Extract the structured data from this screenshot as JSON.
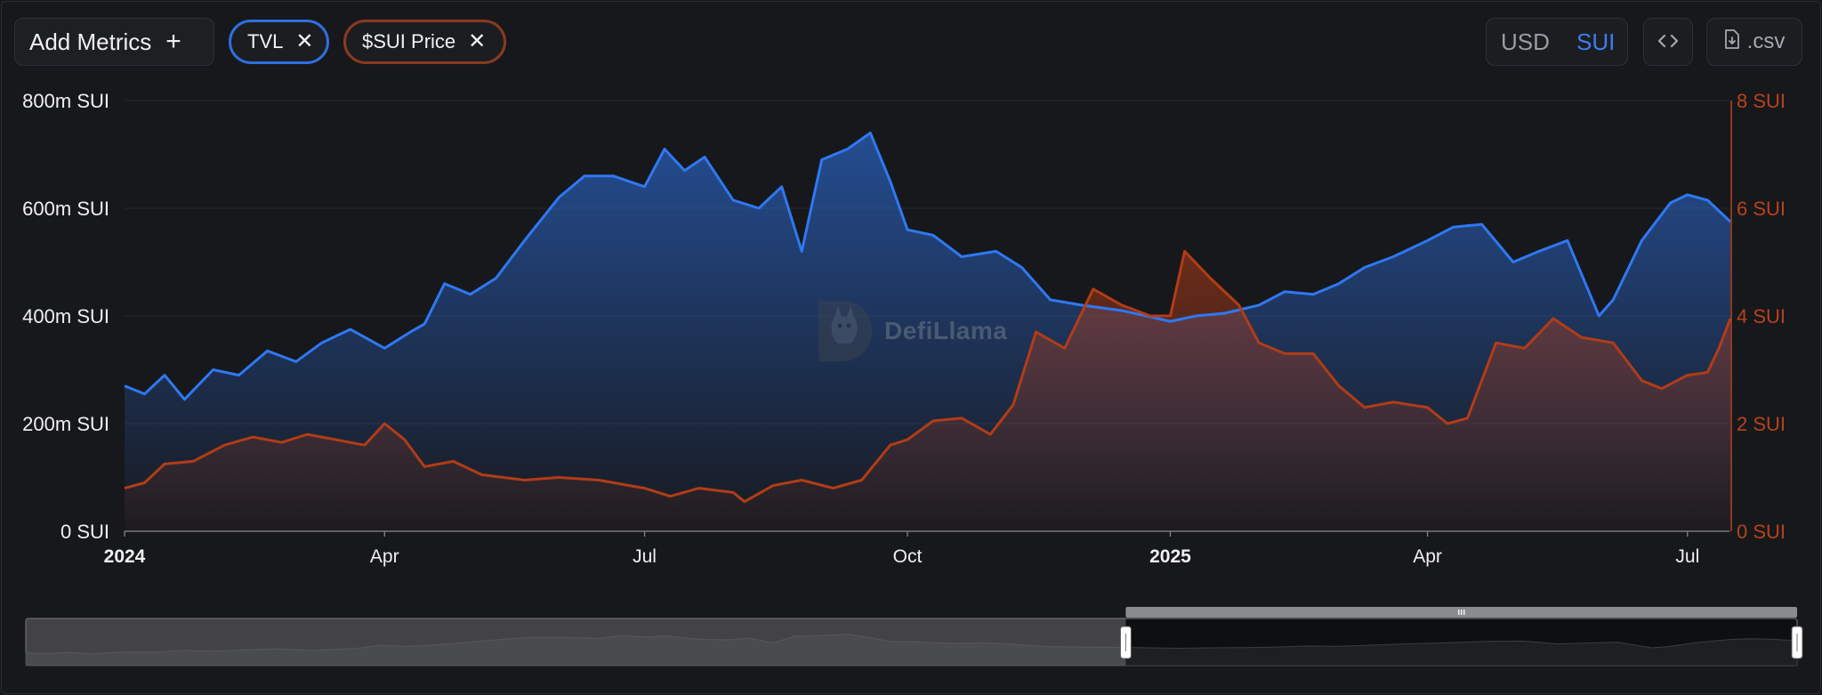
{
  "toolbar": {
    "add_metrics_label": "Add Metrics",
    "metric_pills": [
      {
        "label": "TVL",
        "color": "#2f6fe0"
      },
      {
        "label": "$SUI Price",
        "color": "#8a3a1f"
      }
    ],
    "denomination": {
      "options": [
        "USD",
        "SUI"
      ],
      "selected": "SUI"
    },
    "embed_icon": "code-brackets-icon",
    "csv_label": ".csv",
    "csv_icon": "file-download-icon"
  },
  "watermark": {
    "text": "DefiLlama"
  },
  "colors": {
    "tvl_line": "#2f78f2",
    "price_line": "#b23c17",
    "background": "#17181b",
    "right_axis": "#b8421c"
  },
  "chart_data": {
    "type": "area",
    "x_labels": [
      "2024",
      "Apr",
      "Jul",
      "Oct",
      "2025",
      "Apr",
      "Jul"
    ],
    "bold_x_labels": [
      "2024",
      "2025"
    ],
    "x_label_dates": [
      "2024-01-01",
      "2024-04-01",
      "2024-07-01",
      "2024-10-01",
      "2025-01-01",
      "2025-04-01",
      "2025-07-01"
    ],
    "x_range": [
      "2024-01-01",
      "2025-07-16"
    ],
    "left_axis": {
      "ticks": [
        "0 SUI",
        "200m SUI",
        "400m SUI",
        "600m SUI",
        "800m SUI"
      ],
      "range": [
        0,
        800000000
      ]
    },
    "right_axis": {
      "ticks": [
        "0 SUI",
        "2 SUI",
        "4 SUI",
        "6 SUI",
        "8 SUI"
      ],
      "range": [
        0,
        8
      ]
    },
    "grid": true,
    "series": [
      {
        "name": "TVL",
        "axis": "left",
        "color": "#2f78f2",
        "points": [
          [
            "2024-01-01",
            270000000
          ],
          [
            "2024-01-08",
            255000000
          ],
          [
            "2024-01-15",
            290000000
          ],
          [
            "2024-01-22",
            245000000
          ],
          [
            "2024-02-01",
            300000000
          ],
          [
            "2024-02-10",
            290000000
          ],
          [
            "2024-02-20",
            335000000
          ],
          [
            "2024-03-01",
            315000000
          ],
          [
            "2024-03-10",
            350000000
          ],
          [
            "2024-03-20",
            375000000
          ],
          [
            "2024-04-01",
            340000000
          ],
          [
            "2024-04-10",
            370000000
          ],
          [
            "2024-04-15",
            385000000
          ],
          [
            "2024-04-22",
            460000000
          ],
          [
            "2024-05-01",
            440000000
          ],
          [
            "2024-05-10",
            470000000
          ],
          [
            "2024-05-20",
            540000000
          ],
          [
            "2024-06-01",
            620000000
          ],
          [
            "2024-06-10",
            660000000
          ],
          [
            "2024-06-20",
            660000000
          ],
          [
            "2024-07-01",
            640000000
          ],
          [
            "2024-07-08",
            710000000
          ],
          [
            "2024-07-15",
            670000000
          ],
          [
            "2024-07-22",
            695000000
          ],
          [
            "2024-08-01",
            615000000
          ],
          [
            "2024-08-10",
            600000000
          ],
          [
            "2024-08-18",
            640000000
          ],
          [
            "2024-08-25",
            520000000
          ],
          [
            "2024-09-01",
            690000000
          ],
          [
            "2024-09-10",
            710000000
          ],
          [
            "2024-09-18",
            740000000
          ],
          [
            "2024-09-25",
            650000000
          ],
          [
            "2024-10-01",
            560000000
          ],
          [
            "2024-10-10",
            550000000
          ],
          [
            "2024-10-20",
            510000000
          ],
          [
            "2024-11-01",
            520000000
          ],
          [
            "2024-11-10",
            490000000
          ],
          [
            "2024-11-20",
            430000000
          ],
          [
            "2024-12-01",
            420000000
          ],
          [
            "2024-12-15",
            410000000
          ],
          [
            "2025-01-01",
            390000000
          ],
          [
            "2025-01-10",
            400000000
          ],
          [
            "2025-01-20",
            405000000
          ],
          [
            "2025-02-01",
            420000000
          ],
          [
            "2025-02-10",
            445000000
          ],
          [
            "2025-02-20",
            440000000
          ],
          [
            "2025-03-01",
            460000000
          ],
          [
            "2025-03-10",
            490000000
          ],
          [
            "2025-03-20",
            510000000
          ],
          [
            "2025-04-01",
            540000000
          ],
          [
            "2025-04-10",
            565000000
          ],
          [
            "2025-04-20",
            570000000
          ],
          [
            "2025-05-01",
            500000000
          ],
          [
            "2025-05-10",
            520000000
          ],
          [
            "2025-05-20",
            540000000
          ],
          [
            "2025-05-31",
            400000000
          ],
          [
            "2025-06-05",
            430000000
          ],
          [
            "2025-06-15",
            540000000
          ],
          [
            "2025-06-25",
            610000000
          ],
          [
            "2025-07-01",
            625000000
          ],
          [
            "2025-07-08",
            615000000
          ],
          [
            "2025-07-16",
            575000000
          ]
        ]
      },
      {
        "name": "$SUI Price",
        "axis": "right",
        "color": "#b23c17",
        "points": [
          [
            "2024-01-01",
            0.8
          ],
          [
            "2024-01-08",
            0.9
          ],
          [
            "2024-01-15",
            1.25
          ],
          [
            "2024-01-25",
            1.3
          ],
          [
            "2024-02-05",
            1.6
          ],
          [
            "2024-02-15",
            1.75
          ],
          [
            "2024-02-25",
            1.65
          ],
          [
            "2024-03-05",
            1.8
          ],
          [
            "2024-03-15",
            1.7
          ],
          [
            "2024-03-25",
            1.6
          ],
          [
            "2024-04-01",
            2.0
          ],
          [
            "2024-04-08",
            1.7
          ],
          [
            "2024-04-15",
            1.2
          ],
          [
            "2024-04-25",
            1.3
          ],
          [
            "2024-05-05",
            1.05
          ],
          [
            "2024-05-20",
            0.95
          ],
          [
            "2024-06-01",
            1.0
          ],
          [
            "2024-06-15",
            0.95
          ],
          [
            "2024-07-01",
            0.8
          ],
          [
            "2024-07-10",
            0.65
          ],
          [
            "2024-07-20",
            0.8
          ],
          [
            "2024-08-01",
            0.72
          ],
          [
            "2024-08-05",
            0.55
          ],
          [
            "2024-08-15",
            0.85
          ],
          [
            "2024-08-25",
            0.95
          ],
          [
            "2024-09-05",
            0.8
          ],
          [
            "2024-09-15",
            0.95
          ],
          [
            "2024-09-25",
            1.6
          ],
          [
            "2024-10-01",
            1.7
          ],
          [
            "2024-10-10",
            2.05
          ],
          [
            "2024-10-20",
            2.1
          ],
          [
            "2024-10-30",
            1.8
          ],
          [
            "2024-11-07",
            2.35
          ],
          [
            "2024-11-15",
            3.7
          ],
          [
            "2024-11-25",
            3.4
          ],
          [
            "2024-12-05",
            4.5
          ],
          [
            "2024-12-15",
            4.2
          ],
          [
            "2024-12-25",
            4.0
          ],
          [
            "2025-01-01",
            4.0
          ],
          [
            "2025-01-06",
            5.2
          ],
          [
            "2025-01-15",
            4.7
          ],
          [
            "2025-01-25",
            4.2
          ],
          [
            "2025-02-01",
            3.5
          ],
          [
            "2025-02-10",
            3.3
          ],
          [
            "2025-02-20",
            3.3
          ],
          [
            "2025-03-01",
            2.7
          ],
          [
            "2025-03-10",
            2.3
          ],
          [
            "2025-03-20",
            2.4
          ],
          [
            "2025-04-01",
            2.3
          ],
          [
            "2025-04-08",
            2.0
          ],
          [
            "2025-04-15",
            2.1
          ],
          [
            "2025-04-25",
            3.5
          ],
          [
            "2025-05-05",
            3.4
          ],
          [
            "2025-05-15",
            3.95
          ],
          [
            "2025-05-25",
            3.6
          ],
          [
            "2025-06-05",
            3.5
          ],
          [
            "2025-06-15",
            2.8
          ],
          [
            "2025-06-22",
            2.65
          ],
          [
            "2025-07-01",
            2.9
          ],
          [
            "2025-07-08",
            2.95
          ],
          [
            "2025-07-12",
            3.4
          ],
          [
            "2025-07-16",
            3.95
          ]
        ]
      }
    ],
    "brush": {
      "selected_start": "2024-12-15",
      "selected_end": "2025-07-16"
    }
  }
}
